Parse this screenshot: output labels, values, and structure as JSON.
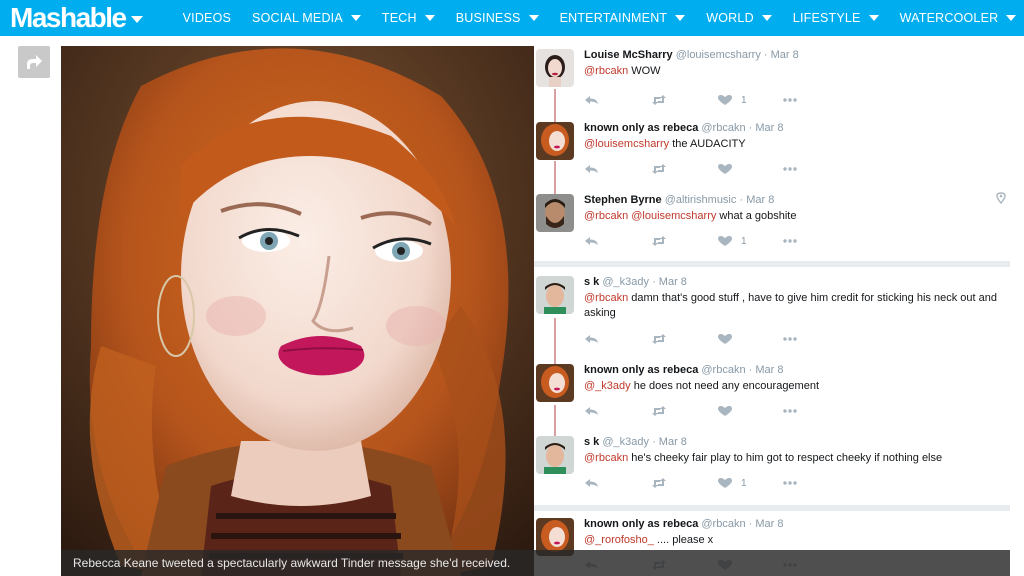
{
  "brand": {
    "logo": "Mashable"
  },
  "colors": {
    "nav_bg": "#00aeef",
    "mention": "#c0392b",
    "meta": "#8899a6"
  },
  "nav": {
    "items": [
      {
        "label": "VIDEOS",
        "has_dropdown": false
      },
      {
        "label": "SOCIAL MEDIA",
        "has_dropdown": true
      },
      {
        "label": "TECH",
        "has_dropdown": true
      },
      {
        "label": "BUSINESS",
        "has_dropdown": true
      },
      {
        "label": "ENTERTAINMENT",
        "has_dropdown": true
      },
      {
        "label": "WORLD",
        "has_dropdown": true
      },
      {
        "label": "LIFESTYLE",
        "has_dropdown": true
      },
      {
        "label": "WATERCOOLER",
        "has_dropdown": true
      }
    ]
  },
  "share": {
    "icon": "share-arrow-icon"
  },
  "caption": "Rebecca Keane tweeted a spectacularly awkward Tinder message she'd received.",
  "tweets": [
    {
      "name": "Louise McSharry",
      "handle": "@louisemcsharry",
      "date": "Mar 8",
      "mention": "@rbcakn",
      "text": " WOW",
      "likes": "1"
    },
    {
      "name": "known only as rebeca",
      "handle": "@rbcakn",
      "date": "Mar 8",
      "mention": "@louisemcsharry",
      "text": " the AUDACITY",
      "likes": ""
    },
    {
      "name": "Stephen Byrne",
      "handle": "@altirishmusic",
      "date": "Mar 8",
      "mention": "@rbcakn @louisemcsharry",
      "text": " what a gobshite",
      "likes": "1"
    },
    {
      "name": "s k",
      "handle": "@_k3ady",
      "date": "Mar 8",
      "mention": "@rbcakn",
      "text": " damn that's good stuff , have to give him credit for sticking his neck out and asking",
      "likes": ""
    },
    {
      "name": "known only as rebeca",
      "handle": "@rbcakn",
      "date": "Mar 8",
      "mention": "@_k3ady",
      "text": " he does not need any encouragement",
      "likes": ""
    },
    {
      "name": "s k",
      "handle": "@_k3ady",
      "date": "Mar 8",
      "mention": "@rbcakn",
      "text": " he's cheeky fair play to him got to respect cheeky if nothing else",
      "likes": "1"
    },
    {
      "name": "known only as rebeca",
      "handle": "@rbcakn",
      "date": "Mar 8",
      "mention": "@_rorofosho_",
      "text": " .... please x",
      "likes": ""
    }
  ],
  "separator_char": "·"
}
